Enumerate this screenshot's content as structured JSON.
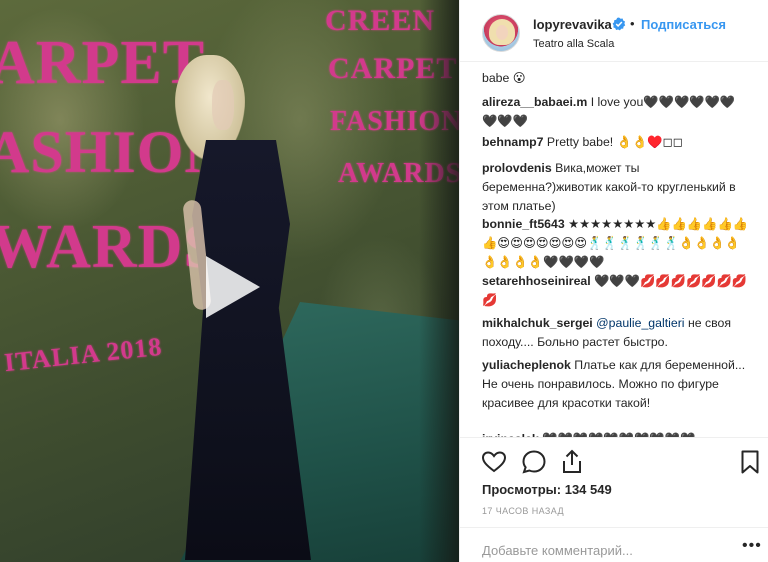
{
  "post": {
    "username": "lopyrevavika",
    "follow_label": "Подписаться",
    "location": "Teatro alla Scala",
    "sign_words": [
      "ARPET",
      "ASHION",
      "WARDS",
      "CREEN",
      "CARPET",
      "FASHION",
      "AWARDS"
    ],
    "sign_small": "ITALIA 2018"
  },
  "comments": [
    {
      "user": "",
      "text": "babe 😮"
    },
    {
      "user": "alireza__babaei.m",
      "text": "I love you🖤🖤🖤🖤🖤🖤🖤🖤🖤"
    },
    {
      "user": "behnamp7",
      "text": "Pretty babe! 👌👌♥️◻◻"
    },
    {
      "user": "prolovdenis",
      "text": "Вика,может ты беременна?)животик какой-то кругленький в этом платье)"
    },
    {
      "user": "bonnie_ft5643",
      "text": "★★★★★★★★👍👍👍👍👍👍👍😍😍😍😍😍😍😍🕺🕺🕺🕺🕺🕺👌👌👌👌👌👌👌👌🖤🖤🖤🖤"
    },
    {
      "user": "setarehhoseinireal",
      "text": "🖤🖤🖤💋💋💋💋💋💋💋💋"
    },
    {
      "user": "mikhalchuk_sergei",
      "mention": "@paulie_galtieri",
      "text": "не своя походу.... Больно растет быстро."
    },
    {
      "user": "yuliacheplenok",
      "text": "Платье как для беременной... Не очень понравилось. Можно по фигуре красивее для красотки такой!"
    },
    {
      "user": "irvinaslak",
      "text": "🖤🖤🖤🖤🖤🖤🖤🖤🖤🖤"
    }
  ],
  "stats": {
    "views_label": "Просмотры:",
    "views_value": "134 549",
    "time_ago": "17 часов назад"
  },
  "add_comment": {
    "placeholder": "Добавьте комментарий...",
    "more_label": "•••"
  },
  "icons": [
    "verified-badge-icon",
    "play-icon",
    "heart-icon",
    "comment-icon",
    "share-icon",
    "bookmark-icon",
    "more-options-icon"
  ],
  "colors": {
    "accent": "#3897f0",
    "sign_pink": "#d23a8c",
    "text": "#262626",
    "muted": "#999999"
  }
}
